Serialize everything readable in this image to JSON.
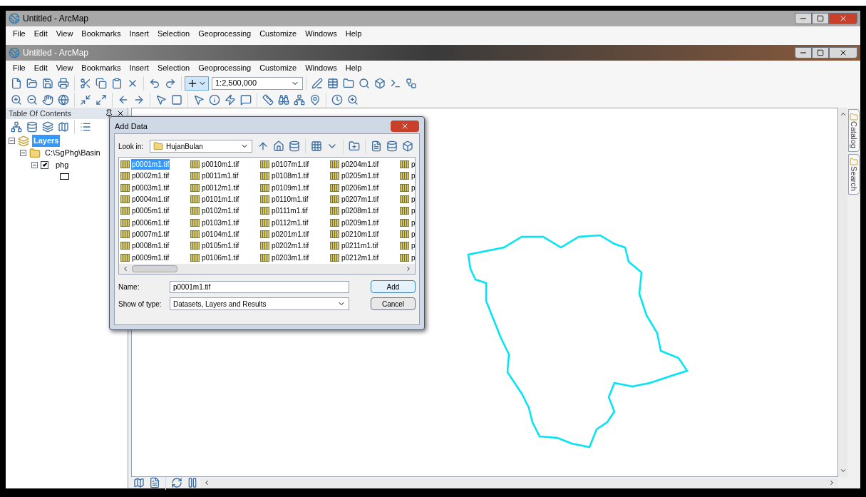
{
  "background_window": {
    "title": "Untitled - ArcMap",
    "menu": [
      "File",
      "Edit",
      "View",
      "Bookmarks",
      "Insert",
      "Selection",
      "Geoprocessing",
      "Customize",
      "Windows",
      "Help"
    ]
  },
  "window": {
    "title": "Untitled - ArcMap",
    "menu": [
      "File",
      "Edit",
      "View",
      "Bookmarks",
      "Insert",
      "Selection",
      "Geoprocessing",
      "Customize",
      "Windows",
      "Help"
    ]
  },
  "toolbar": {
    "scale": "1:2,500,000"
  },
  "toc": {
    "title": "Table Of Contents",
    "tree": [
      {
        "label": "Layers",
        "kind": "frame",
        "selected": true,
        "expanded": true,
        "children": [
          {
            "label": "C:\\SgPhg\\Basin",
            "kind": "folder",
            "selected": false,
            "expanded": true,
            "children": [
              {
                "label": "phg",
                "kind": "layer",
                "selected": false,
                "expanded": true,
                "checked": true
              }
            ]
          }
        ]
      }
    ]
  },
  "dialog": {
    "title": "Add Data",
    "look_in_label": "Look in:",
    "look_in": "HujanBulan",
    "files": [
      {
        "name": "p0001m1.tif",
        "selected": true
      },
      {
        "name": "p0002m1.tif",
        "selected": false
      },
      {
        "name": "p0003m1.tif",
        "selected": false
      },
      {
        "name": "p0004m1.tif",
        "selected": false
      },
      {
        "name": "p0005m1.tif",
        "selected": false
      },
      {
        "name": "p0006m1.tif",
        "selected": false
      },
      {
        "name": "p0007m1.tif",
        "selected": false
      },
      {
        "name": "p0008m1.tif",
        "selected": false
      },
      {
        "name": "p0009m1.tif",
        "selected": false
      },
      {
        "name": "p0010m1.tif",
        "selected": false
      },
      {
        "name": "p0011m1.tif",
        "selected": false
      },
      {
        "name": "p0012m1.tif",
        "selected": false
      },
      {
        "name": "p0101m1.tif",
        "selected": false
      },
      {
        "name": "p0102m1.tif",
        "selected": false
      },
      {
        "name": "p0103m1.tif",
        "selected": false
      },
      {
        "name": "p0104m1.tif",
        "selected": false
      },
      {
        "name": "p0105m1.tif",
        "selected": false
      },
      {
        "name": "p0106m1.tif",
        "selected": false
      },
      {
        "name": "p0107m1.tif",
        "selected": false
      },
      {
        "name": "p0108m1.tif",
        "selected": false
      },
      {
        "name": "p0109m1.tif",
        "selected": false
      },
      {
        "name": "p0110m1.tif",
        "selected": false
      },
      {
        "name": "p0111m1.tif",
        "selected": false
      },
      {
        "name": "p0112m1.tif",
        "selected": false
      },
      {
        "name": "p0201m1.tif",
        "selected": false
      },
      {
        "name": "p0202m1.tif",
        "selected": false
      },
      {
        "name": "p0203m1.tif",
        "selected": false
      },
      {
        "name": "p0204m1.tif",
        "selected": false
      },
      {
        "name": "p0205m1.tif",
        "selected": false
      },
      {
        "name": "p0206m1.tif",
        "selected": false
      },
      {
        "name": "p0207m1.tif",
        "selected": false
      },
      {
        "name": "p0208m1.tif",
        "selected": false
      },
      {
        "name": "p0209m1.tif",
        "selected": false
      },
      {
        "name": "p0210m1.tif",
        "selected": false
      },
      {
        "name": "p0211m1.tif",
        "selected": false
      },
      {
        "name": "p0212m1.tif",
        "selected": false
      },
      {
        "name": "p",
        "selected": false
      },
      {
        "name": "p",
        "selected": false
      },
      {
        "name": "p",
        "selected": false
      },
      {
        "name": "p",
        "selected": false
      },
      {
        "name": "p",
        "selected": false
      },
      {
        "name": "p",
        "selected": false
      },
      {
        "name": "p",
        "selected": false
      },
      {
        "name": "p",
        "selected": false
      },
      {
        "name": "p",
        "selected": false
      }
    ],
    "name_label": "Name:",
    "name_value": "p0001m1.tif",
    "type_label": "Show of type:",
    "type_value": "Datasets, Layers and Results",
    "buttons": [
      "Add",
      "Cancel"
    ]
  },
  "side_tabs": [
    "Catalog",
    "Search"
  ]
}
